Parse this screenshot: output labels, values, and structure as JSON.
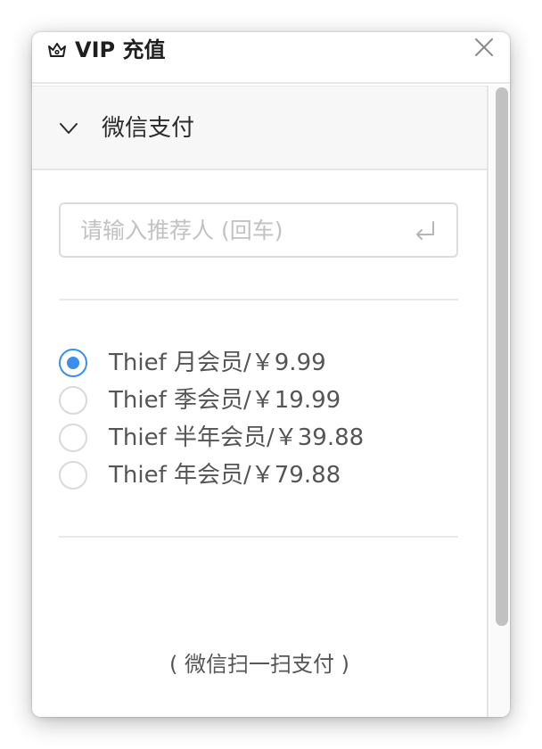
{
  "window": {
    "title": "VIP 充值",
    "title_icon": "crown-icon",
    "close_icon": "close-icon"
  },
  "panel": {
    "title": "微信支付",
    "expanded": true,
    "chevron_icon": "chevron-down-icon"
  },
  "referrer_input": {
    "placeholder": "请输入推荐人 (回车)",
    "value": "",
    "enter_icon": "enter-icon"
  },
  "plans": [
    {
      "label": "Thief 月会员/￥9.99",
      "selected": true
    },
    {
      "label": "Thief 季会员/￥19.99",
      "selected": false
    },
    {
      "label": "Thief 半年会员/￥39.88",
      "selected": false
    },
    {
      "label": "Thief 年会员/￥79.88",
      "selected": false
    }
  ],
  "footer_note": "( 微信扫一扫支付 )",
  "colors": {
    "accent": "#3b8ef0",
    "panel_header_bg": "#f7f7f7",
    "scrollbar_thumb": "#c1c1c1"
  }
}
